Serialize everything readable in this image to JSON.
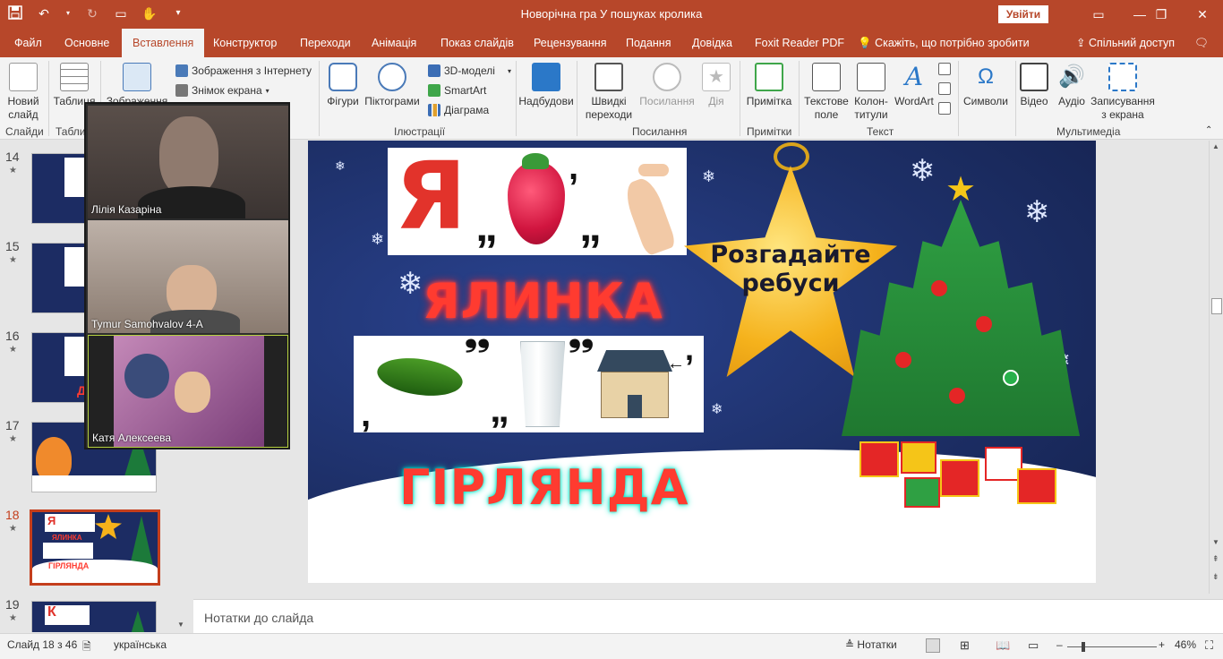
{
  "window": {
    "title": "Новорічна гра У пошуках кролика",
    "login_button": "Увійти"
  },
  "tabs": [
    "Файл",
    "Основне",
    "Вставлення",
    "Конструктор",
    "Переходи",
    "Анімація",
    "Показ слайдів",
    "Рецензування",
    "Подання",
    "Довідка",
    "Foxit Reader PDF"
  ],
  "tell_me": "Скажіть, що потрібно зробити",
  "share": "Спільний доступ",
  "ribbon": {
    "new_slide": "Новий",
    "new_slide_2": "слайд",
    "table": "Таблиця",
    "image": "Зображення",
    "online_images": "Зображення з Інтернету",
    "screenshot": "Знімок екрана",
    "shapes": "Фігури",
    "icons": "Піктограми",
    "models_3d": "3D-моделі",
    "smartart": "SmartArt",
    "chart": "Діаграма",
    "addins": "Надбудови",
    "quick_links": "Швидкі",
    "quick_links_2": "переходи",
    "link": "Посилання",
    "action": "Дія",
    "comment": "Примітка",
    "textbox": "Текстове",
    "textbox_2": "поле",
    "header_footer": "Колон-",
    "header_footer_2": "титули",
    "wordart": "WordArt",
    "symbols": "Символи",
    "video": "Відео",
    "audio": "Аудіо",
    "screen_record": "Записування",
    "screen_record_2": "з екрана",
    "groups": {
      "slides": "Слайди",
      "tables": "Табли",
      "illustrations": "Ілюстрації",
      "links": "Посилання",
      "comments": "Примітки",
      "text": "Текст",
      "media": "Мультимедіа"
    }
  },
  "slides_panel": {
    "numbers": [
      "14",
      "15",
      "16",
      "17",
      "18",
      "19"
    ],
    "active": "18"
  },
  "zoom_participants": [
    "Лілія Казаріна",
    "Tymur Samohvalov 4-A",
    "Катя Алексеева"
  ],
  "slide": {
    "star_text_1": "Розгадайте",
    "star_text_2": "ребуси",
    "rebus1_letter": "Я",
    "answer1": "ЯЛИНКА",
    "answer2": "ГІРЛЯНДА",
    "quote_mark": "„",
    "comma": ","
  },
  "notes_placeholder": "Нотатки до слайда",
  "status": {
    "slide_counter": "Слайд 18 з 46",
    "language": "українська",
    "notes_button": "Нотатки",
    "zoom": "46%",
    "minus": "–",
    "plus": "+"
  },
  "colors": {
    "accent": "#b7472a",
    "slide_bg": "#1d2f67",
    "answer_text": "#ff3b30",
    "answer_glow_1": "#00e6c8"
  }
}
